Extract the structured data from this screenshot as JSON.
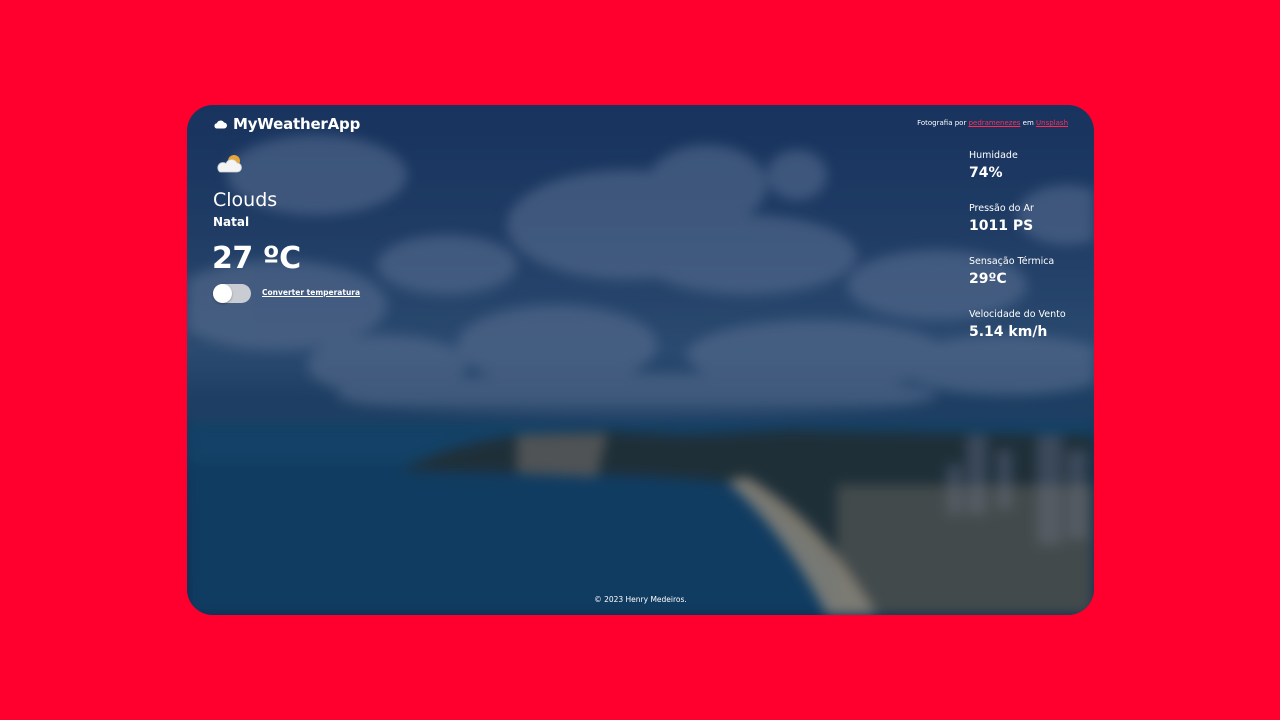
{
  "app": {
    "title": "MyWeatherApp",
    "logo_icon": "cloud-icon"
  },
  "credit": {
    "prefix": "Fotografia por",
    "author": "pedramenezes",
    "connector": "em",
    "site": "Unsplash"
  },
  "weather": {
    "icon": "cloud-sun-icon",
    "condition": "Clouds",
    "city": "Natal",
    "temperature": "27 ºC"
  },
  "toggle": {
    "label": "Converter temperatura",
    "state": "off"
  },
  "stats": [
    {
      "label": "Humidade",
      "value": "74%"
    },
    {
      "label": "Pressão do Ar",
      "value": "1011 PS"
    },
    {
      "label": "Sensação Térmica",
      "value": "29ºC"
    },
    {
      "label": "Velocidade do Vento",
      "value": "5.14 km/h"
    }
  ],
  "footer": "© 2023 Henry Medeiros.",
  "colors": {
    "page_background": "#ff002e",
    "accent_link": "#ff2d55",
    "text": "#ffffff"
  }
}
